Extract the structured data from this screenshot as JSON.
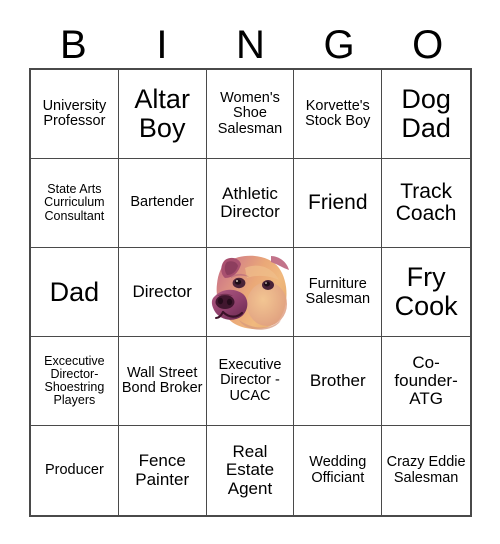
{
  "card": {
    "title": "BINGO",
    "header_letters": [
      "B",
      "I",
      "N",
      "G",
      "O"
    ],
    "colors": {
      "border": "#4a4a4a",
      "text": "#000000",
      "background": "#ffffff"
    }
  },
  "grid": {
    "columns": 5,
    "rows": 5,
    "cells": [
      {
        "text": "University Professor",
        "size": "s"
      },
      {
        "text": "Altar Boy",
        "size": "xl"
      },
      {
        "text": "Women's Shoe Salesman",
        "size": "s"
      },
      {
        "text": "Korvette's Stock Boy",
        "size": "s"
      },
      {
        "text": "Dog Dad",
        "size": "xl"
      },
      {
        "text": "State Arts Curriculum Consultant",
        "size": "xs"
      },
      {
        "text": "Bartender",
        "size": "s"
      },
      {
        "text": "Athletic Director",
        "size": "m"
      },
      {
        "text": "Friend",
        "size": "l"
      },
      {
        "text": "Track Coach",
        "size": "l"
      },
      {
        "text": "Dad",
        "size": "xl"
      },
      {
        "text": "Director",
        "size": "m"
      },
      {
        "text": "",
        "size": "s",
        "free_space": true,
        "icon": "dog-photo"
      },
      {
        "text": "Furniture Salesman",
        "size": "s"
      },
      {
        "text": "Fry Cook",
        "size": "xl"
      },
      {
        "text": "Excecutive Director-Shoestring Players",
        "size": "xs"
      },
      {
        "text": "Wall Street Bond Broker",
        "size": "s"
      },
      {
        "text": "Executive Director - UCAC",
        "size": "s"
      },
      {
        "text": "Brother",
        "size": "m"
      },
      {
        "text": "Co-founder-ATG",
        "size": "m"
      },
      {
        "text": "Producer",
        "size": "s"
      },
      {
        "text": "Fence Painter",
        "size": "m"
      },
      {
        "text": "Real Estate Agent",
        "size": "m"
      },
      {
        "text": "Wedding Officiant",
        "size": "s"
      },
      {
        "text": "Crazy Eddie Salesman",
        "size": "s"
      }
    ]
  }
}
